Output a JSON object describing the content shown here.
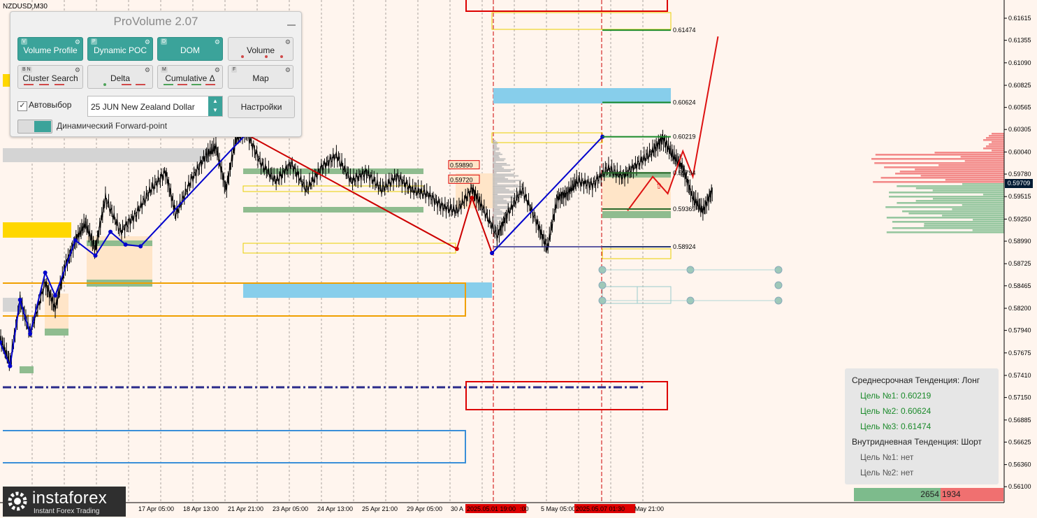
{
  "symbol": "NZDUSD,M30",
  "panel": {
    "title": "ProVolume 2.07",
    "buttons": [
      {
        "key": "V",
        "label": "Volume Profile",
        "active": true
      },
      {
        "key": "P",
        "label": "Dynamic POC",
        "active": true
      },
      {
        "key": "D",
        "label": "DOM",
        "active": true
      },
      {
        "key": "",
        "label": "Volume",
        "active": false
      },
      {
        "key": "B N",
        "label": "Cluster Search",
        "active": false
      },
      {
        "key": "",
        "label": "Delta",
        "active": false
      },
      {
        "key": "M",
        "label": "Cumulative Δ",
        "active": false
      },
      {
        "key": "F",
        "label": "Map",
        "active": false
      }
    ],
    "auto_select_label": "Автовыбор",
    "auto_select_checked": true,
    "instrument_value": "25 JUN New Zealand Dollar",
    "settings_label": "Настройки",
    "forward_point_label": "Динамический Forward-point",
    "accent_color": "#3ba39a"
  },
  "trend_box": {
    "medium_term": "Среднесрочная Тенденция: Лонг",
    "target1": "Цель №1: 0.60219",
    "target2": "Цель №2: 0.60624",
    "target3": "Цель №3: 0.61474",
    "intraday": "Внутридневная Тенденция: Шорт",
    "intraday_t1": "Цель №1: нет",
    "intraday_t2": "Цель №2: нет"
  },
  "volume_bar": {
    "buy": "2654",
    "sell": "1934"
  },
  "logo": {
    "name": "instaforex",
    "sub": "Instant Forex Trading"
  },
  "current_price": "0.59709",
  "chart_data": {
    "type": "candlestick",
    "ylim": [
      0.5597,
      0.6178
    ],
    "y_ticks": [
      "0.61615",
      "0.61355",
      "0.61090",
      "0.60825",
      "0.60565",
      "0.60305",
      "0.60040",
      "0.59780",
      "0.59515",
      "0.59250",
      "0.58990",
      "0.58725",
      "0.58465",
      "0.58200",
      "0.57940",
      "0.57675",
      "0.57410",
      "0.57150",
      "0.56885",
      "0.56625",
      "0.56360",
      "0.56100"
    ],
    "x_labels": [
      "17 Apr 05:00",
      "18 Apr 13:00",
      "21 Apr 21:00",
      "23 Apr 05:00",
      "24 Apr 13:00",
      "25 Apr 21:00",
      "29 Apr 05:00",
      "30 A",
      "2025.05.01 19:00",
      ":00",
      "5 May 05:00",
      "2025.05.07 01:30",
      "May 21:00"
    ],
    "price_path": [
      [
        0.0,
        0.5785
      ],
      [
        0.01,
        0.5755
      ],
      [
        0.02,
        0.583
      ],
      [
        0.03,
        0.579
      ],
      [
        0.045,
        0.585
      ],
      [
        0.055,
        0.582
      ],
      [
        0.065,
        0.587
      ],
      [
        0.075,
        0.59
      ],
      [
        0.085,
        0.592
      ],
      [
        0.095,
        0.589
      ],
      [
        0.105,
        0.595
      ],
      [
        0.12,
        0.591
      ],
      [
        0.135,
        0.593
      ],
      [
        0.15,
        0.596
      ],
      [
        0.165,
        0.598
      ],
      [
        0.175,
        0.593
      ],
      [
        0.19,
        0.597
      ],
      [
        0.205,
        0.6
      ],
      [
        0.215,
        0.601
      ],
      [
        0.225,
        0.596
      ],
      [
        0.235,
        0.602
      ],
      [
        0.245,
        0.6028
      ],
      [
        0.26,
        0.599
      ],
      [
        0.275,
        0.597
      ],
      [
        0.29,
        0.599
      ],
      [
        0.305,
        0.596
      ],
      [
        0.32,
        0.5985
      ],
      [
        0.335,
        0.6
      ],
      [
        0.35,
        0.597
      ],
      [
        0.365,
        0.598
      ],
      [
        0.38,
        0.596
      ],
      [
        0.395,
        0.5975
      ],
      [
        0.41,
        0.596
      ],
      [
        0.425,
        0.5955
      ],
      [
        0.44,
        0.594
      ],
      [
        0.455,
        0.5935
      ],
      [
        0.47,
        0.596
      ],
      [
        0.48,
        0.594
      ],
      [
        0.495,
        0.5905
      ],
      [
        0.505,
        0.593
      ],
      [
        0.52,
        0.596
      ],
      [
        0.535,
        0.592
      ],
      [
        0.545,
        0.589
      ],
      [
        0.555,
        0.595
      ],
      [
        0.565,
        0.5955
      ],
      [
        0.575,
        0.597
      ],
      [
        0.59,
        0.5965
      ],
      [
        0.605,
        0.5985
      ],
      [
        0.62,
        0.5975
      ],
      [
        0.635,
        0.599
      ],
      [
        0.65,
        0.6005
      ],
      [
        0.66,
        0.602
      ],
      [
        0.67,
        0.6
      ],
      [
        0.68,
        0.5985
      ],
      [
        0.69,
        0.595
      ],
      [
        0.7,
        0.5935
      ],
      [
        0.71,
        0.596
      ]
    ],
    "zigzag_blue": [
      [
        0.0,
        0.578
      ],
      [
        0.01,
        0.5752
      ],
      [
        0.02,
        0.583
      ],
      [
        0.03,
        0.579
      ],
      [
        0.045,
        0.5862
      ],
      [
        0.055,
        0.5835
      ],
      [
        0.075,
        0.59
      ],
      [
        0.095,
        0.5882
      ],
      [
        0.11,
        0.591
      ],
      [
        0.125,
        0.5895
      ],
      [
        0.14,
        0.5893
      ],
      [
        0.245,
        0.6025
      ]
    ],
    "zigzag_red": [
      [
        0.245,
        0.6025
      ],
      [
        0.455,
        0.589
      ],
      [
        0.47,
        0.595
      ],
      [
        0.49,
        0.5885
      ]
    ],
    "zigzag_blue2": [
      [
        0.49,
        0.5885
      ],
      [
        0.6,
        0.6022
      ]
    ],
    "forecast_red": [
      [
        0.625,
        0.5935
      ],
      [
        0.65,
        0.5975
      ],
      [
        0.665,
        0.5955
      ],
      [
        0.68,
        0.6005
      ],
      [
        0.69,
        0.5975
      ],
      [
        0.715,
        0.614
      ]
    ],
    "levels": [
      {
        "price": 0.61474,
        "label": "0.61474",
        "color": "#1a8a2a"
      },
      {
        "price": 0.60624,
        "label": "0.60624",
        "color": "#1a8a2a"
      },
      {
        "price": 0.60219,
        "label": "0.60219",
        "color": "#1a8a2a"
      },
      {
        "price": 0.59794,
        "label": "0.59794",
        "color": "#000000"
      },
      {
        "price": 0.59369,
        "label": "0.59369",
        "color": "#000000"
      },
      {
        "price": 0.58924,
        "label": "0.58924",
        "color": "#000000"
      }
    ],
    "price_tags": [
      {
        "price": 0.5989,
        "label": "0.59890"
      },
      {
        "price": 0.5972,
        "label": "0.59720"
      }
    ],
    "colors": {
      "bull": "#000000",
      "zigzag_blue": "#0000cc",
      "zigzag_red": "#cc0000",
      "vol_profile": "#f07070",
      "vol_profile_green": "#7dbb8c"
    }
  }
}
